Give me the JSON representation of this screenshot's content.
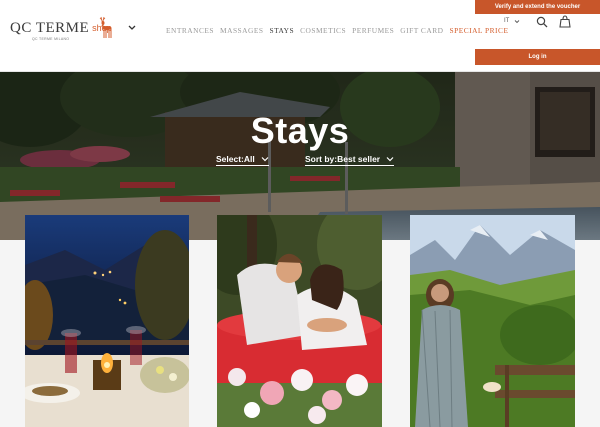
{
  "header": {
    "logo_main": "QC TERME",
    "logo_shop": "shop",
    "logo_sub": "QC TERME MILANO",
    "nav": [
      {
        "label": "ENTRANCES",
        "state": "normal"
      },
      {
        "label": "MASSAGES",
        "state": "normal"
      },
      {
        "label": "STAYS",
        "state": "active"
      },
      {
        "label": "COSMETICS",
        "state": "normal"
      },
      {
        "label": "PERFUMES",
        "state": "normal"
      },
      {
        "label": "GIFT CARD",
        "state": "normal"
      },
      {
        "label": "SPECIAL PRICE",
        "state": "special"
      }
    ],
    "voucher_label": "Verify and extend the voucher",
    "language": "IT",
    "login_label": "Log in"
  },
  "hero": {
    "title": "Stays",
    "select_label": "Select:All",
    "sort_label": "Sort by:Best seller"
  },
  "colors": {
    "accent": "#c8562a",
    "nav_text": "#9a9a9a",
    "nav_active": "#3a3a3a",
    "nav_special": "#d45d2c"
  },
  "icons": [
    "deer-logo-icon",
    "chevron-down-icon",
    "search-icon",
    "shopping-bag-icon"
  ],
  "cards": [
    {
      "image": "candlelit dinner table with mountain valley view at night"
    },
    {
      "image": "couple in bathrobes relaxing on red lounger with flowers"
    },
    {
      "image": "woman on balcony overlooking green forest and mountains"
    }
  ]
}
